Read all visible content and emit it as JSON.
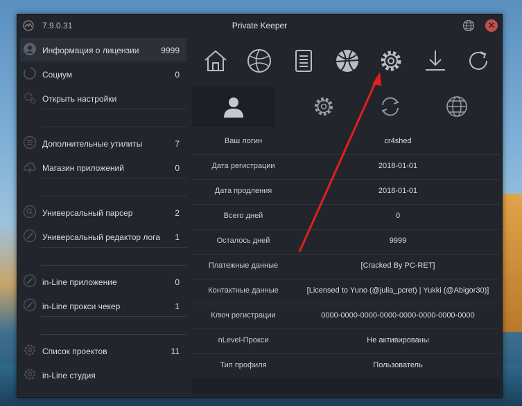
{
  "window": {
    "version": "7.9.0.31",
    "title": "Private Keeper",
    "close_glyph": "✕"
  },
  "sidebar": {
    "items": [
      {
        "icon": "user-circle-icon",
        "label": "Информация о лицензии",
        "count": "9999"
      },
      {
        "icon": "ring-icon",
        "label": "Социум",
        "count": "0"
      },
      {
        "icon": "gears-icon",
        "label": "Открыть настройки",
        "count": ""
      },
      {
        "icon": "list-icon",
        "label": "Дополнительные утилиты",
        "count": "7"
      },
      {
        "icon": "cloud-icon",
        "label": "Магазин приложений",
        "count": "0"
      },
      {
        "icon": "search-icon",
        "label": "Универсальный парсер",
        "count": "2"
      },
      {
        "icon": "pen-icon",
        "label": "Универсальный редактор лога",
        "count": "1"
      },
      {
        "icon": "pen-icon",
        "label": "in-Line приложение",
        "count": "0"
      },
      {
        "icon": "pen-icon",
        "label": "in-Line прокси чекер",
        "count": "1"
      },
      {
        "icon": "gear-icon",
        "label": "Список проектов",
        "count": "11"
      },
      {
        "icon": "gear-icon",
        "label": "in-Line студия",
        "count": ""
      }
    ]
  },
  "toolbar": {
    "icons": [
      "home-icon",
      "globe-icon",
      "notebook-icon",
      "basketball-icon",
      "settings-icon",
      "download-icon",
      "refresh-icon"
    ]
  },
  "subtabs": {
    "icons": [
      "profile-icon",
      "settings-icon",
      "sync-icon",
      "globe-icon"
    ]
  },
  "license": {
    "rows": [
      {
        "key": "Ваш логин",
        "value": "cr4shed"
      },
      {
        "key": "Дата регистрации",
        "value": "2018-01-01"
      },
      {
        "key": "Дата продления",
        "value": "2018-01-01"
      },
      {
        "key": "Всего дней",
        "value": "0"
      },
      {
        "key": "Осталось дней",
        "value": "9999"
      },
      {
        "key": "Платежные данные",
        "value": "[Cracked By PC-RET]"
      },
      {
        "key": "Контактные данные",
        "value": "[Licensed to Yuno (@julia_pcret) | Yukki (@Abigor30)]"
      },
      {
        "key": "Ключ регистрации",
        "value": "0000-0000-0000-0000-0000-0000-0000-0000"
      },
      {
        "key": "nLevel-Прокси",
        "value": "Не активированы"
      },
      {
        "key": "Тип профиля",
        "value": "Пользователь"
      }
    ]
  },
  "colors": {
    "window_bg": "#22252c",
    "accent_red": "#e02020",
    "close_red": "#c0504a"
  }
}
